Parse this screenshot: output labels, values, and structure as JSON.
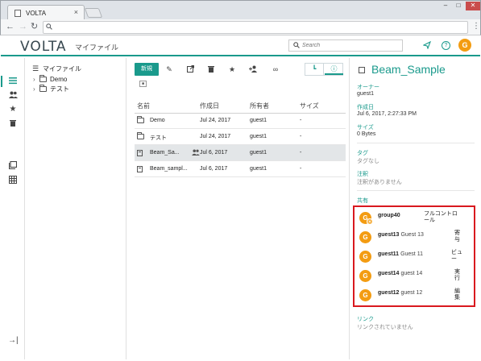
{
  "browser": {
    "tab_title": "VOLTA",
    "tab_close": "×",
    "win_min": "–",
    "win_max": "□",
    "win_close": "✕",
    "address": "",
    "menu": "⋮"
  },
  "header": {
    "logo": "VOLTA",
    "title": "マイファイル",
    "search_placeholder": "Search",
    "user_initial": "G"
  },
  "tree": {
    "root_label": "マイファイル",
    "items": [
      {
        "label": "Demo"
      },
      {
        "label": "テスト"
      }
    ]
  },
  "toolbar": {
    "new_label": "新規"
  },
  "table": {
    "headers": [
      "名前",
      "作成日",
      "所有者",
      "サイズ"
    ],
    "rows": [
      {
        "name": "Demo",
        "date": "Jul 24, 2017",
        "owner": "guest1",
        "size": "-",
        "kind": "folder"
      },
      {
        "name": "テスト",
        "date": "Jul 24, 2017",
        "owner": "guest1",
        "size": "-",
        "kind": "folder"
      },
      {
        "name": "Beam_Sa...",
        "date": "Jul 6, 2017",
        "owner": "guest1",
        "size": "-",
        "kind": "file"
      },
      {
        "name": "Beam_sampl...",
        "date": "Jul 6, 2017",
        "owner": "guest1",
        "size": "-",
        "kind": "file"
      }
    ]
  },
  "details": {
    "title": "Beam_Sample",
    "owner_label": "オーナー",
    "owner": "guest1",
    "created_label": "作成日",
    "created": "Jul 6, 2017, 2:27:33 PM",
    "size_label": "サイズ",
    "size": "0 Bytes",
    "tags_label": "タグ",
    "tags": "タグなし",
    "notes_label": "注釈",
    "notes": "注釈がありません",
    "share_label": "共有",
    "shares": [
      {
        "initial": "G",
        "name": "group40",
        "sub": "",
        "role_lines": [
          "フルコントロ",
          "ール"
        ],
        "group": true
      },
      {
        "initial": "G",
        "name": "guest13",
        "sub": "Guest 13",
        "role_lines": [
          "寄",
          "与"
        ],
        "group": false
      },
      {
        "initial": "G",
        "name": "guest11",
        "sub": "Guest 11",
        "role_lines": [
          "ビュ",
          "ー"
        ],
        "group": false
      },
      {
        "initial": "G",
        "name": "guest14",
        "sub": "guest 14",
        "role_lines": [
          "実",
          "行"
        ],
        "group": false
      },
      {
        "initial": "G",
        "name": "guest12",
        "sub": "guest 12",
        "role_lines": [
          "編",
          "集"
        ],
        "group": false
      }
    ],
    "link_label": "リンク",
    "link": "リンクされていません"
  },
  "colors": {
    "accent": "#1a9a8c",
    "avatar": "#f39c12",
    "highlight_border": "#d9191f"
  }
}
